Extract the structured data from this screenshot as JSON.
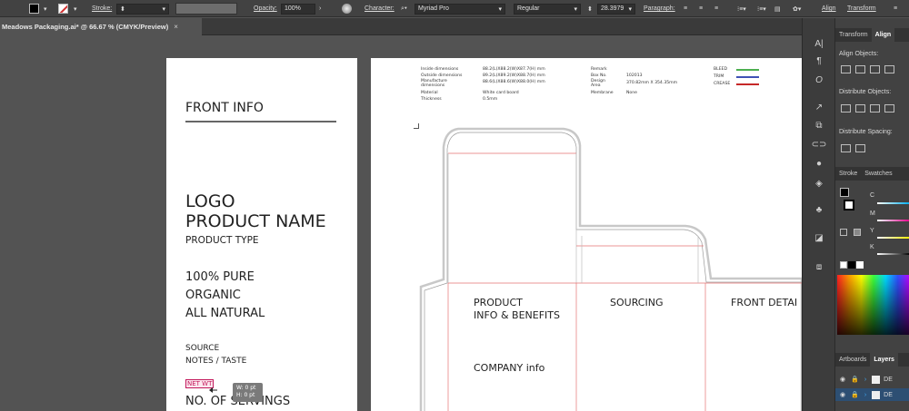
{
  "control_bar": {
    "stroke_label": "Stroke:",
    "opacity_label": "Opacity:",
    "opacity_value": "100%",
    "character_label": "Character:",
    "font_family": "Myriad Pro",
    "font_style": "Regular",
    "font_size": "28.3979",
    "paragraph_label": "Paragraph:",
    "align_label": "Align",
    "transform_label": "Transform"
  },
  "document_tab": {
    "title": "Meadows Packaging.ai* @ 66.67 % (CMYK/Preview)",
    "close": "×"
  },
  "artboard_front": {
    "heading": "FRONT INFO",
    "logo": "LOGO",
    "product_name": "PRODUCT NAME",
    "product_type": "PRODUCT TYPE",
    "claims": [
      "100% PURE",
      "ORGANIC",
      "ALL NATURAL"
    ],
    "source": "SOURCE",
    "notes": "NOTES / TASTE",
    "net_wt": "NET WT",
    "servings": "NO. OF SERVINGS",
    "tooltip": "W: 0 pt\nH: 0 pt"
  },
  "dieline": {
    "specs_left": [
      {
        "label": "Inside dimensions",
        "value": "88.2(L)X88.2(W)X87.7(H) mm"
      },
      {
        "label": "Outside dimensions",
        "value": "89.2(L)X89.2(W)X88.7(H) mm"
      },
      {
        "label": "Manufacture dimensions",
        "value": "88.6(L)X88.6(W)X88.0(H) mm"
      },
      {
        "label": "Material",
        "value": "White card board"
      },
      {
        "label": "Thickness",
        "value": "0.5mm"
      }
    ],
    "specs_right": [
      {
        "label": "Remark",
        "value": ""
      },
      {
        "label": "Box No.",
        "value": "102013"
      },
      {
        "label": "Design Area",
        "value": "370.82mm X 354.35mm"
      },
      {
        "label": "Membrane",
        "value": "None"
      }
    ],
    "legend": [
      {
        "label": "BLEED",
        "color": "#4caf50"
      },
      {
        "label": "TRIM",
        "color": "#3f51b5"
      },
      {
        "label": "CREASE",
        "color": "#c62828"
      }
    ],
    "panel_labels": {
      "product_info_line1": "PRODUCT",
      "product_info_line2": "INFO & BENEFITS",
      "sourcing": "SOURCING",
      "front_detail": "FRONT DETAI",
      "company_info": "COMPANY info"
    }
  },
  "panels": {
    "top_tabs": [
      "Transform",
      "Align"
    ],
    "align_objects": "Align Objects:",
    "distribute_objects": "Distribute Objects:",
    "distribute_spacing": "Distribute Spacing:",
    "color_tabs": [
      "Stroke",
      "Swatches"
    ],
    "cmyk": [
      "C",
      "M",
      "Y",
      "K"
    ],
    "bottom_tabs": [
      "Artboards",
      "Layers"
    ],
    "layer_names": [
      "DE",
      "DE"
    ]
  }
}
